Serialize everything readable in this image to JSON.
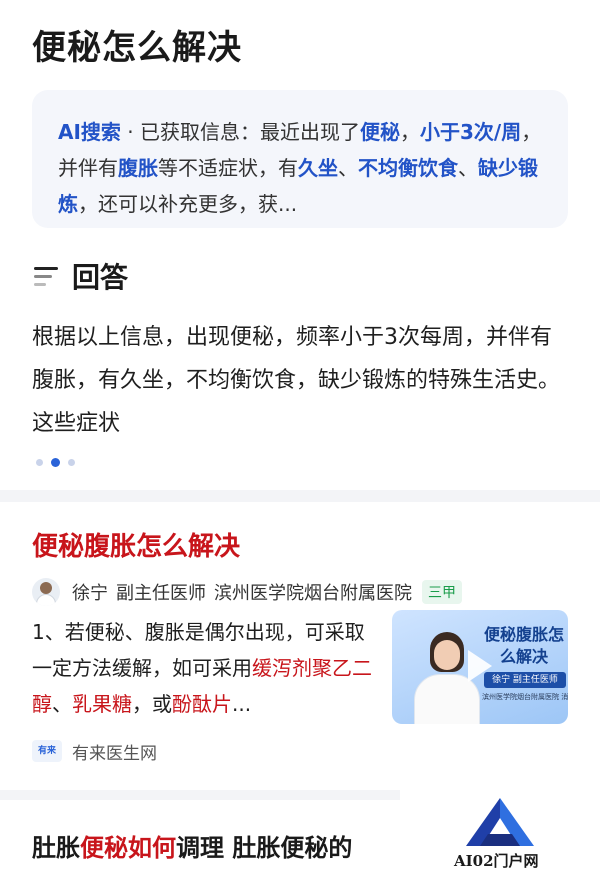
{
  "page_title": "便秘怎么解决",
  "ai_summary": {
    "brand": "AI搜索",
    "sep": " · ",
    "prefix": "已获取信息：最近出现了",
    "kw1": "便秘",
    "c1": "，",
    "kw2": "小于3次/周",
    "c2": "，并伴有",
    "kw3": "腹胀",
    "c3": "等不适症状，有",
    "kw4": "久坐",
    "c4": "、",
    "kw5": "不均衡饮食",
    "c5": "、",
    "kw6": "缺少锻炼",
    "suffix": "，还可以补充更多，获..."
  },
  "answer": {
    "title": "回答",
    "body": "根据以上信息，出现便秘，频率小于3次每周，并伴有腹胀，有久坐，不均衡饮食，缺少锻炼的特殊生活史。这些症状"
  },
  "carousel": {
    "count": 3,
    "active_index": 1
  },
  "result1": {
    "title": "便秘腹胀怎么解决",
    "doctor_name": "徐宁",
    "doctor_title": "副主任医师",
    "hospital": "滨州医学院烟台附属医院",
    "badge": "三甲",
    "snippet_a": "1、若便秘、腹胀是偶尔出现，可采取一定方法缓解，如可采用",
    "snippet_red1": "缓泻剂聚乙二醇",
    "snippet_b": "、",
    "snippet_red2": "乳果糖",
    "snippet_c": "，或",
    "snippet_red3": "酚酞片",
    "snippet_d": "...",
    "video_title": "便秘腹胀怎么解决",
    "video_doctor": "徐宁 副主任医师",
    "video_caption": "滨州医学院烟台附属医院 消化",
    "source_logo": "有来",
    "source_name": "有来医生网"
  },
  "result2": {
    "title_a": "肚胀",
    "title_red": "便秘如何",
    "title_b": "调理 肚胀便秘的"
  },
  "watermark": {
    "text": "AI02门户网"
  },
  "colors": {
    "accent_blue": "#2253c7",
    "accent_red": "#c8151b",
    "badge_green": "#1a9c4a"
  },
  "icons": [
    "list-lines-icon",
    "play-icon",
    "doctor-avatar-icon",
    "source-logo-icon"
  ]
}
